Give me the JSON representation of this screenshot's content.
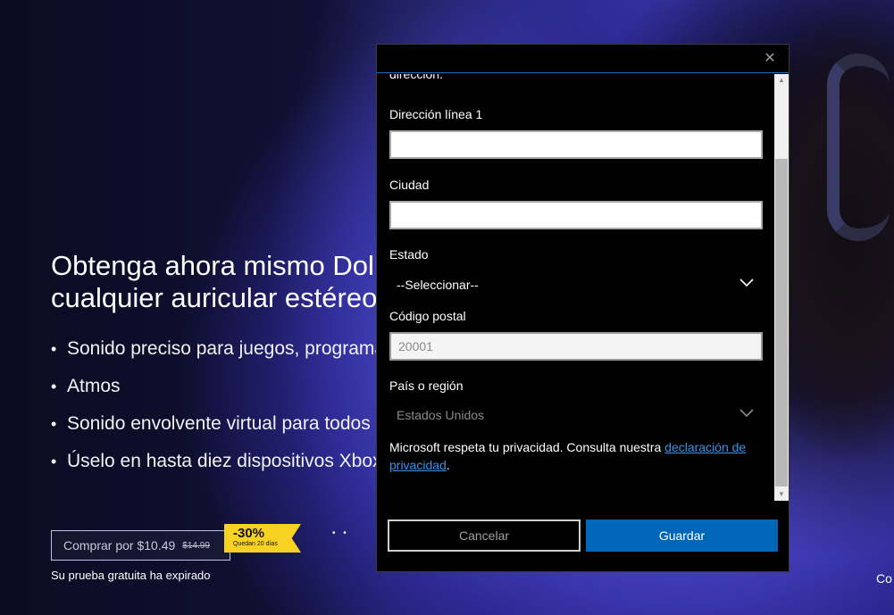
{
  "hero": {
    "title_line1": "Obtenga ahora mismo Dolby Atmos para",
    "title_line2": "cualquier auricular estéreo",
    "bullets": [
      "Sonido preciso para juegos, programas y películas con Dolby",
      "Atmos",
      "Sonido envolvente virtual para todos sus auriculares",
      "Úselo en hasta diez dispositivos Xbox y Windows"
    ],
    "buy_label": "Comprar por $10.49",
    "old_price": "$14.99",
    "discount_pct": "-30%",
    "discount_days": "Quedan 20 días",
    "trial_expired": "Su prueba gratuita ha expirado",
    "corner_text": "Co"
  },
  "modal": {
    "close_symbol": "✕",
    "cut_text": "dirección.",
    "address_label": "Dirección línea 1",
    "address_value": "",
    "city_label": "Ciudad",
    "city_value": "",
    "state_label": "Estado",
    "state_selected": "--Seleccionar--",
    "zip_label": "Código postal",
    "zip_value": "20001",
    "country_label": "País o región",
    "country_selected": "Estados Unidos",
    "privacy_text": "Microsoft respeta tu privacidad. Consulta nuestra ",
    "privacy_link": "declaración de privacidad",
    "privacy_end": ".",
    "cancel_label": "Cancelar",
    "save_label": "Guardar"
  },
  "colors": {
    "accent": "#0067b8",
    "link": "#3b93e8",
    "badge": "#f8d223"
  }
}
